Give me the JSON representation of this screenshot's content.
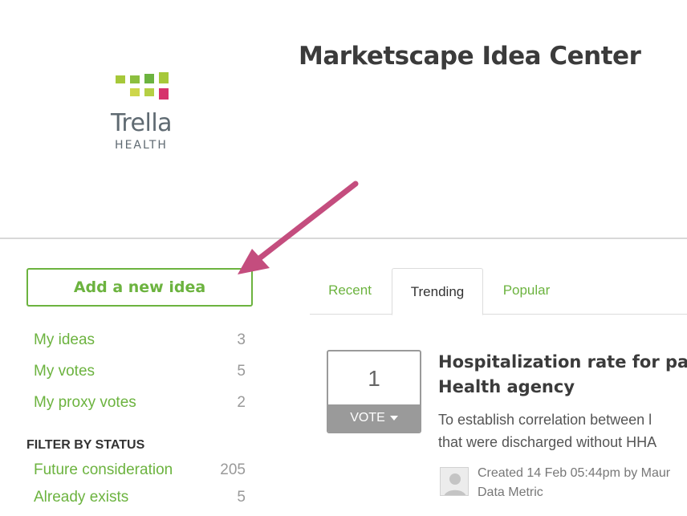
{
  "logo": {
    "wordmark": "Trella",
    "subtitle": "HEALTH"
  },
  "header": {
    "title": "Marketscape Idea Center"
  },
  "sidebar": {
    "add_button": "Add a new idea",
    "items": [
      {
        "label": "My ideas",
        "count": "3"
      },
      {
        "label": "My votes",
        "count": "5"
      },
      {
        "label": "My proxy votes",
        "count": "2"
      }
    ],
    "filter_heading": "FILTER BY STATUS",
    "statuses": [
      {
        "label": "Future consideration",
        "count": "205"
      },
      {
        "label": "Already exists",
        "count": "5"
      }
    ]
  },
  "tabs": [
    {
      "label": "Recent"
    },
    {
      "label": "Trending"
    },
    {
      "label": "Popular"
    }
  ],
  "active_tab": "Trending",
  "idea": {
    "votes": "1",
    "vote_label": "VOTE",
    "title_line1": "Hospitalization rate for patie",
    "title_line2": "Health agency",
    "desc_line1": "To establish correlation between l",
    "desc_line2": "that were discharged without HHA",
    "meta_line1": "Created 14 Feb 05:44pm by Maur",
    "meta_line2": "Data Metric"
  },
  "colors": {
    "accent": "#6cb33f",
    "arrow": "#c44d7e",
    "vote_gray": "#9a9a9a"
  }
}
